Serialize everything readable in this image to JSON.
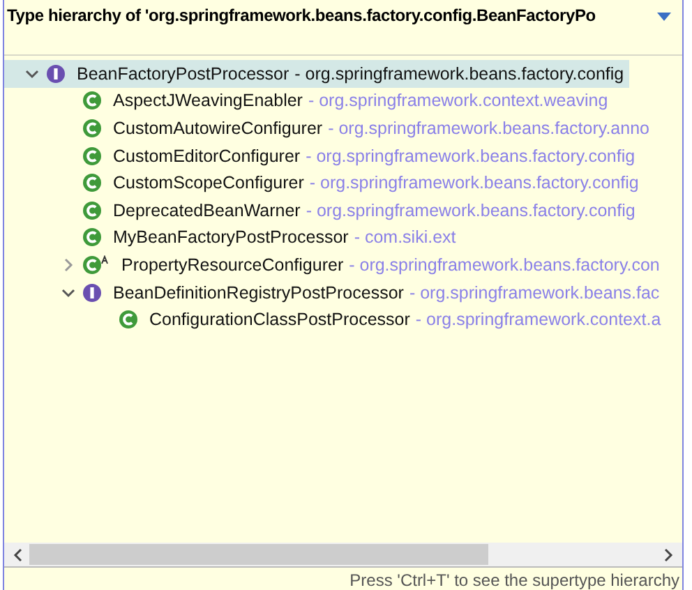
{
  "popup": {
    "title": "Type hierarchy of 'org.springframework.beans.factory.config.BeanFactoryPo",
    "tree": [
      {
        "name": "BeanFactoryPostProcessor",
        "package": "- org.springframework.beans.factory.config",
        "kind": "interface",
        "selected": true,
        "expanded": true,
        "children": [
          {
            "name": "AspectJWeavingEnabler",
            "package": "- org.springframework.context.weaving",
            "kind": "class",
            "selected": false
          },
          {
            "name": "CustomAutowireConfigurer",
            "package": "- org.springframework.beans.factory.anno",
            "kind": "class",
            "selected": false
          },
          {
            "name": "CustomEditorConfigurer",
            "package": "- org.springframework.beans.factory.config",
            "kind": "class",
            "selected": false
          },
          {
            "name": "CustomScopeConfigurer",
            "package": "- org.springframework.beans.factory.config",
            "kind": "class",
            "selected": false
          },
          {
            "name": "DeprecatedBeanWarner",
            "package": "- org.springframework.beans.factory.config",
            "kind": "class",
            "selected": false
          },
          {
            "name": "MyBeanFactoryPostProcessor",
            "package": "- com.siki.ext",
            "kind": "class",
            "selected": false
          },
          {
            "name": "PropertyResourceConfigurer",
            "package": "- org.springframework.beans.factory.con",
            "kind": "abstract-class",
            "selected": false,
            "expanded": false
          },
          {
            "name": "BeanDefinitionRegistryPostProcessor",
            "package": "- org.springframework.beans.fac",
            "kind": "interface",
            "selected": false,
            "expanded": true,
            "children": [
              {
                "name": "ConfigurationClassPostProcessor",
                "package": "- org.springframework.context.a",
                "kind": "class",
                "selected": false
              }
            ]
          }
        ]
      }
    ],
    "status": "Press 'Ctrl+T' to see the supertype hierarchy"
  }
}
